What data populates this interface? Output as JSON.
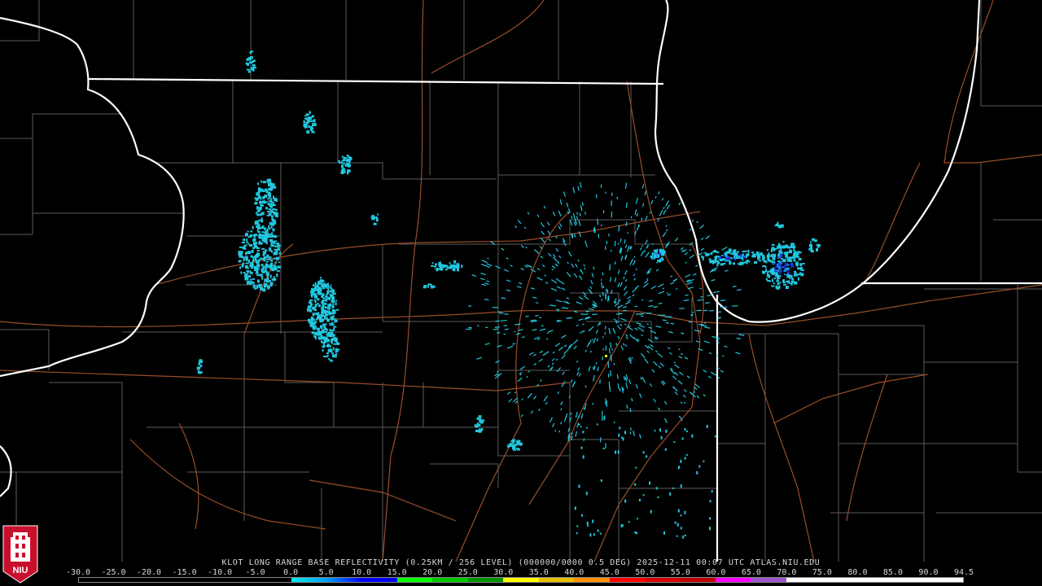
{
  "header": {
    "product_line": "KLOT LONG RANGE BASE REFLECTIVITY (0.25KM / 256 LEVEL) (000000/0000 0.5 DEG) 2025-12-11 00:07 UTC  ATLAS.NIU.EDU"
  },
  "legend": {
    "ticks": [
      "-30.0",
      "-25.0",
      "-20.0",
      "-15.0",
      "-10.0",
      "-5.0",
      "0.0",
      "5.0",
      "10.0",
      "15.0",
      "20.0",
      "25.0",
      "30.0",
      "35.0",
      "40.0",
      "45.0",
      "50.0",
      "55.0",
      "60.0",
      "65.0",
      "70.0",
      "75.0",
      "80.0",
      "85.0",
      "90.0",
      "94.5"
    ],
    "colors": [
      "#000000",
      "#000000",
      "#000000",
      "#000000",
      "#000000",
      "#000000",
      "#00ecec",
      "#01a0f6",
      "#0000f6",
      "#00ff00",
      "#00c800",
      "#009000",
      "#ffff00",
      "#e7c000",
      "#ff9000",
      "#ff0000",
      "#d60000",
      "#c00000",
      "#ff00ff",
      "#9955c9",
      "#ffffff",
      "#ffffff",
      "#ffffff",
      "#ffffff",
      "#ffffff"
    ]
  },
  "logo": {
    "text": "NIU",
    "colors": {
      "shield": "#c8102e",
      "tower": "#ffffff"
    }
  },
  "map": {
    "colors": {
      "background": "#000000",
      "state_border": "#ffffff",
      "county_border": "#7a7a7a",
      "highway": "#9a4e2a",
      "echo_light": "#20c8e0",
      "echo_mid": "#1a8cf0",
      "echo_heavy": "#1a3cf0"
    }
  }
}
